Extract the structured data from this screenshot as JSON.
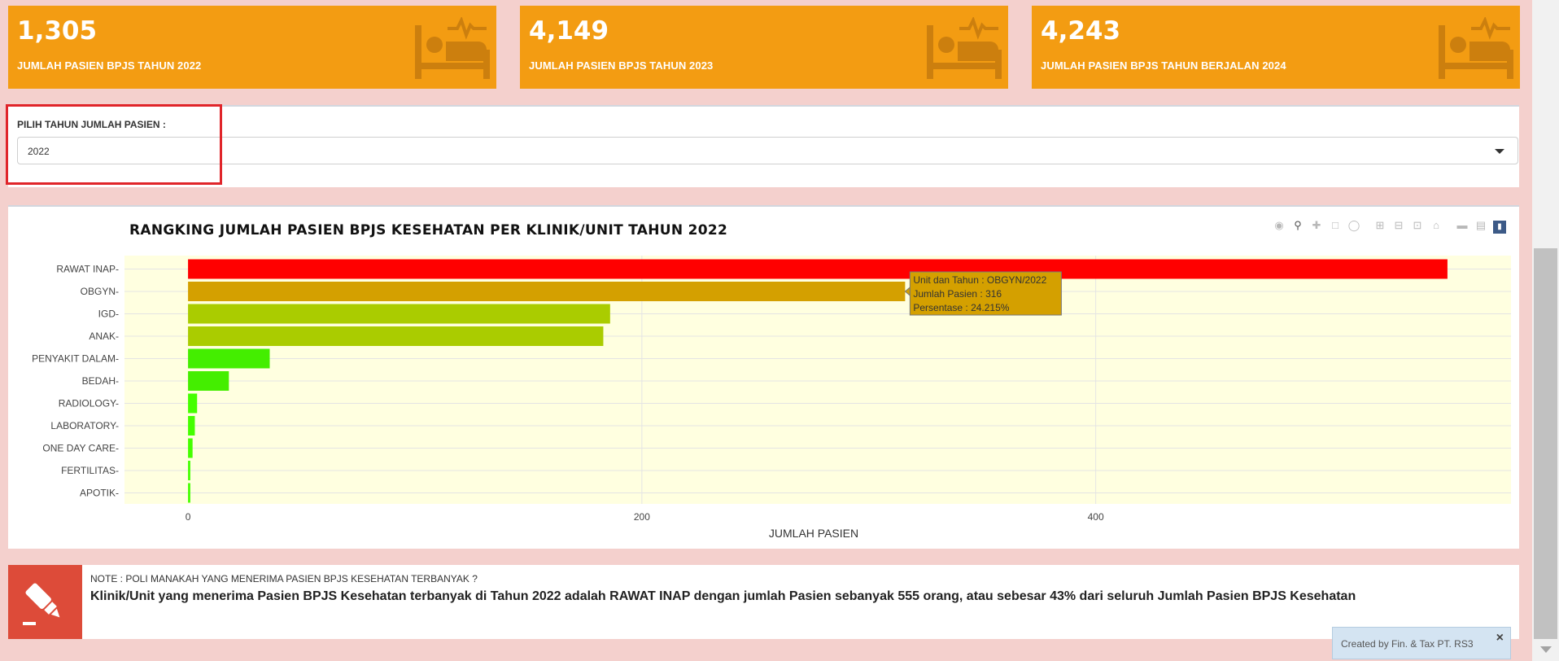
{
  "value_boxes": [
    {
      "value": "1,305",
      "label": "JUMLAH PASIEN BPJS TAHUN 2022",
      "icon": "bed-pulse-icon"
    },
    {
      "value": "4,149",
      "label": "JUMLAH PASIEN BPJS TAHUN 2023",
      "icon": "bed-pulse-icon"
    },
    {
      "value": "4,243",
      "label": "JUMLAH PASIEN BPJS TAHUN BERJALAN 2024",
      "icon": "bed-pulse-icon"
    }
  ],
  "colors": {
    "value_box_bg": "#f39c12",
    "icon_shade": "#cc7f0e",
    "highlight": "#e0252a",
    "note_icon_bg": "#dd4b39",
    "plot_bg": "#ffffe0"
  },
  "year_select": {
    "label": "PILIH TAHUN JUMLAH PASIEN :",
    "selected": "2022"
  },
  "chart_data": {
    "type": "bar",
    "orientation": "horizontal",
    "title": "RANGKING JUMLAH PASIEN BPJS KESEHATAN PER KLINIK/UNIT TAHUN 2022",
    "xlabel": "JUMLAH PASIEN",
    "ylabel": "",
    "xlim": [
      -28,
      583
    ],
    "xticks": [
      0,
      200,
      400
    ],
    "grid": true,
    "categories": [
      "RAWAT INAP",
      "OBGYN",
      "IGD",
      "ANAK",
      "PENYAKIT DALAM",
      "BEDAH",
      "RADIOLOGY",
      "LABORATORY",
      "ONE DAY CARE",
      "FERTILITAS",
      "APOTIK"
    ],
    "values": [
      555,
      316,
      186,
      183,
      36,
      18,
      4,
      3,
      2,
      1,
      1
    ],
    "colors": [
      "#ff0000",
      "#d4a000",
      "#aacc00",
      "#aacc00",
      "#44ee00",
      "#44ee00",
      "#44ff00",
      "#44ff00",
      "#44ff00",
      "#44ff00",
      "#44ff00"
    ],
    "tooltip": {
      "lines": [
        "Unit dan Tahun : OBGYN/2022",
        "Jumlah Pasien : 316",
        "Persentase : 24.215%"
      ],
      "category": "OBGYN"
    }
  },
  "modebar": [
    "camera-icon",
    "zoom-icon",
    "pan-icon",
    "box-select-icon",
    "lasso-icon",
    "zoom-in-icon",
    "zoom-out-icon",
    "autoscale-icon",
    "reset-axes-icon",
    "spike-lines-icon",
    "compare-hover-icon",
    "plotly-logo-icon"
  ],
  "note": {
    "question": "NOTE : POLI MANAKAH YANG MENERIMA PASIEN BPJS KESEHATAN TERBANYAK ?",
    "answer": "Klinik/Unit yang menerima Pasien BPJS Kesehatan terbanyak di Tahun 2022 adalah RAWAT INAP dengan jumlah Pasien sebanyak 555 orang, atau sebesar 43% dari seluruh Jumlah Pasien BPJS Kesehatan",
    "icon": "highlighter-icon"
  },
  "toast": {
    "text": "Created by Fin. & Tax PT. RS3",
    "close": "×"
  }
}
